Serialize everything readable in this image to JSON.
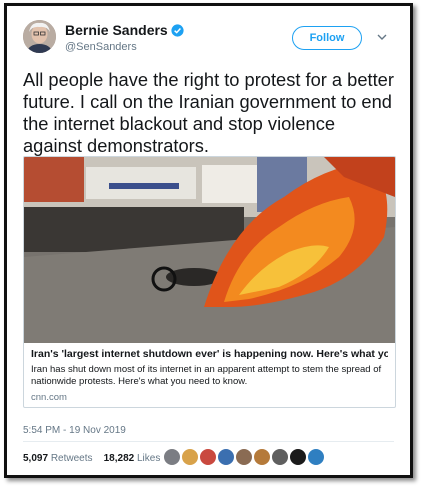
{
  "author": {
    "name": "Bernie Sanders",
    "handle": "@SenSanders",
    "follow_label": "Follow"
  },
  "tweet": {
    "text": "All people have the right to protest for a better future. I call on the Iranian government to end the internet blackout and stop violence against demonstrators.",
    "timestamp": "5:54 PM - 19 Nov 2019"
  },
  "card": {
    "title": "Iran's 'largest internet shutdown ever' is happening now. Here's what you nee...",
    "description": "Iran has shut down most of its internet in an apparent attempt to stem the spread of nationwide protests. Here's what you need to know.",
    "domain": "cnn.com"
  },
  "stats": {
    "retweets_count": "5,097",
    "retweets_label": "Retweets",
    "likes_count": "18,282",
    "likes_label": "Likes"
  },
  "colors": {
    "accent": "#1da1f2",
    "text": "#14171a",
    "muted": "#657786"
  },
  "icons": [
    "verified-badge-icon",
    "chevron-down-icon"
  ]
}
